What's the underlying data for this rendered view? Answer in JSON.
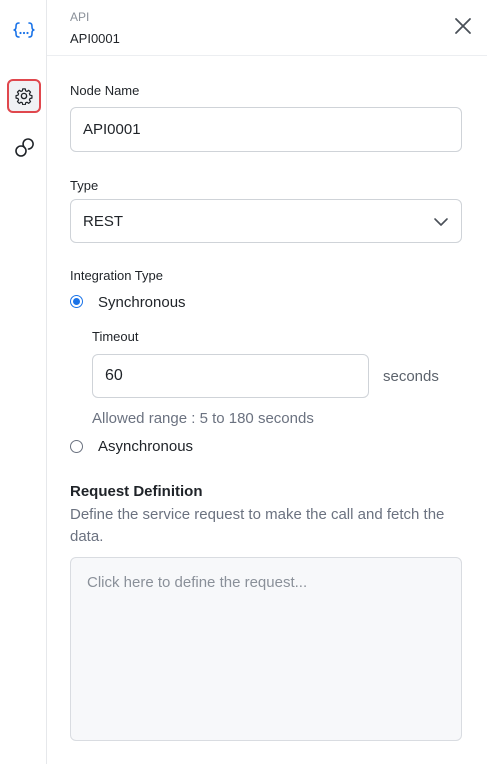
{
  "rail": {
    "icons": [
      "api-icon",
      "gear-icon",
      "link-icon"
    ],
    "active_border_color": "#e0474d"
  },
  "header": {
    "node_type": "API",
    "node_id": "API0001",
    "close_icon": "close-icon"
  },
  "form": {
    "node_name": {
      "label": "Node Name",
      "value": "API0001"
    },
    "type": {
      "label": "Type",
      "selected": "REST"
    },
    "integration_type": {
      "label": "Integration Type",
      "options": [
        {
          "label": "Synchronous",
          "checked": true
        },
        {
          "label": "Asynchronous",
          "checked": false
        }
      ],
      "timeout": {
        "label": "Timeout",
        "value": "60",
        "unit": "seconds",
        "hint": "Allowed range : 5 to 180 seconds"
      }
    },
    "request_definition": {
      "title": "Request Definition",
      "description": "Define the service request to make the call and fetch the data.",
      "placeholder": "Click here to define the request..."
    }
  },
  "colors": {
    "accent": "#1a73e8",
    "api_icon": "#1a73e8"
  }
}
